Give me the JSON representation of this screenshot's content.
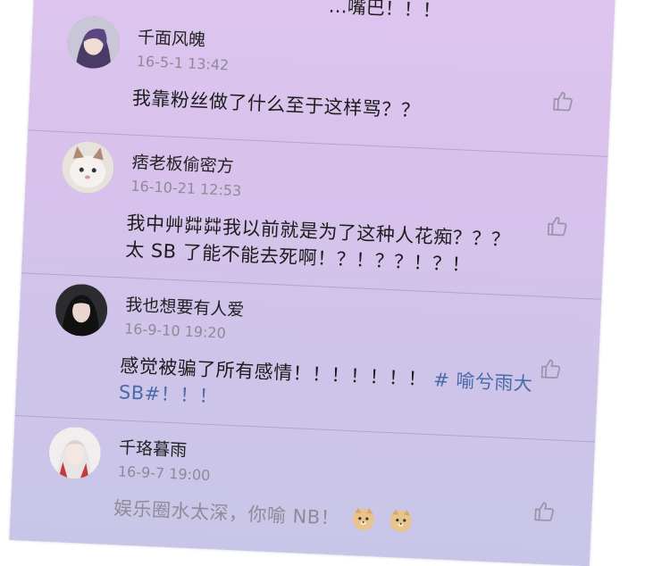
{
  "top_fragment": "…嘴巴！！！",
  "comments": [
    {
      "name": "千面风魄",
      "time": "16-5-1 13:42",
      "text": "我靠粉丝做了什么至于这样骂？？",
      "avatar": "avatar-anime-purple"
    },
    {
      "name": "痞老板偷密方",
      "time": "16-10-21 12:53",
      "text_line1": "我中艸茻茻我以前就是为了这种人花痴？？？",
      "text_line2": "太 SB 了能不能去死啊！？！？？！？！",
      "avatar": "avatar-cat"
    },
    {
      "name": "我也想要有人爱",
      "time": "16-9-10 19:20",
      "text_main": "感觉被骗了所有感情！！！！！！！",
      "text_tag": "# 喻兮雨大",
      "text_line2": "SB#！！！",
      "avatar": "avatar-girl"
    },
    {
      "name": "千珞暮雨",
      "time": "16-9-7 19:00",
      "text": "娱乐圈水太深，你喻 NB！",
      "emojis": [
        "doge-emoji",
        "doge-emoji"
      ],
      "avatar": "avatar-anime-red"
    }
  ],
  "icons": {
    "like": "thumbs-up-icon"
  }
}
